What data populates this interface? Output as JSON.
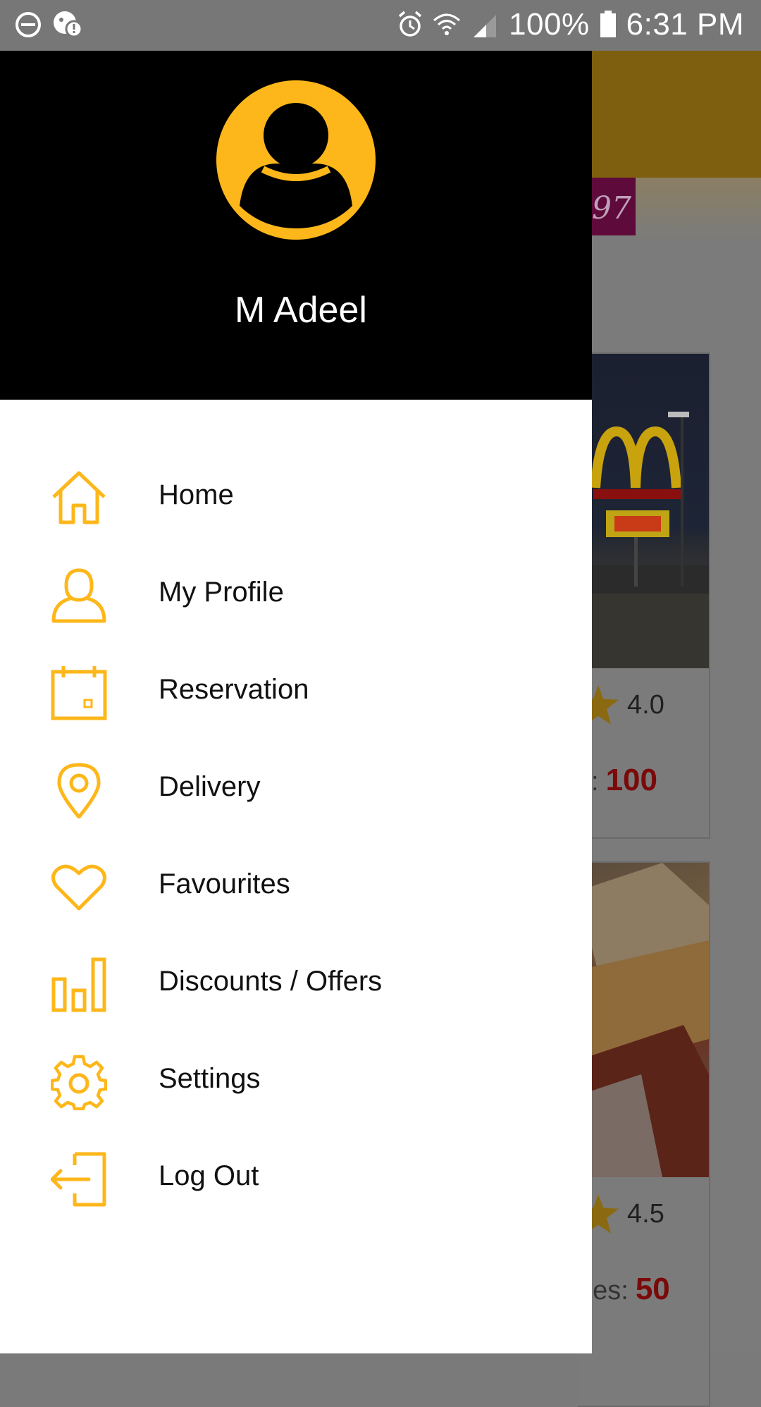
{
  "status_bar": {
    "battery": "100%",
    "time": "6:31 PM",
    "icons": [
      "do-not-disturb-icon",
      "notification-icon",
      "alarm-icon",
      "wifi-icon",
      "signal-icon",
      "battery-icon"
    ]
  },
  "drawer": {
    "user_name": "M Adeel",
    "items": [
      {
        "label": "Home",
        "icon": "home-icon"
      },
      {
        "label": "My Profile",
        "icon": "profile-icon"
      },
      {
        "label": "Reservation",
        "icon": "calendar-icon"
      },
      {
        "label": "Delivery",
        "icon": "location-pin-icon"
      },
      {
        "label": "Favourites",
        "icon": "heart-icon"
      },
      {
        "label": "Discounts / Offers",
        "icon": "bar-chart-icon"
      },
      {
        "label": "Settings",
        "icon": "gear-icon"
      },
      {
        "label": "Log Out",
        "icon": "logout-icon"
      }
    ]
  },
  "background": {
    "promo_text": "97",
    "cards": [
      {
        "rating": "4.0",
        "discount_label": "s:",
        "discount_value": "100"
      },
      {
        "rating": "4.5",
        "discount_label": "ges:",
        "discount_value": "50"
      }
    ]
  },
  "colors": {
    "accent": "#FDB71A",
    "drawer_header": "#000000",
    "discount_value": "#C00000"
  }
}
